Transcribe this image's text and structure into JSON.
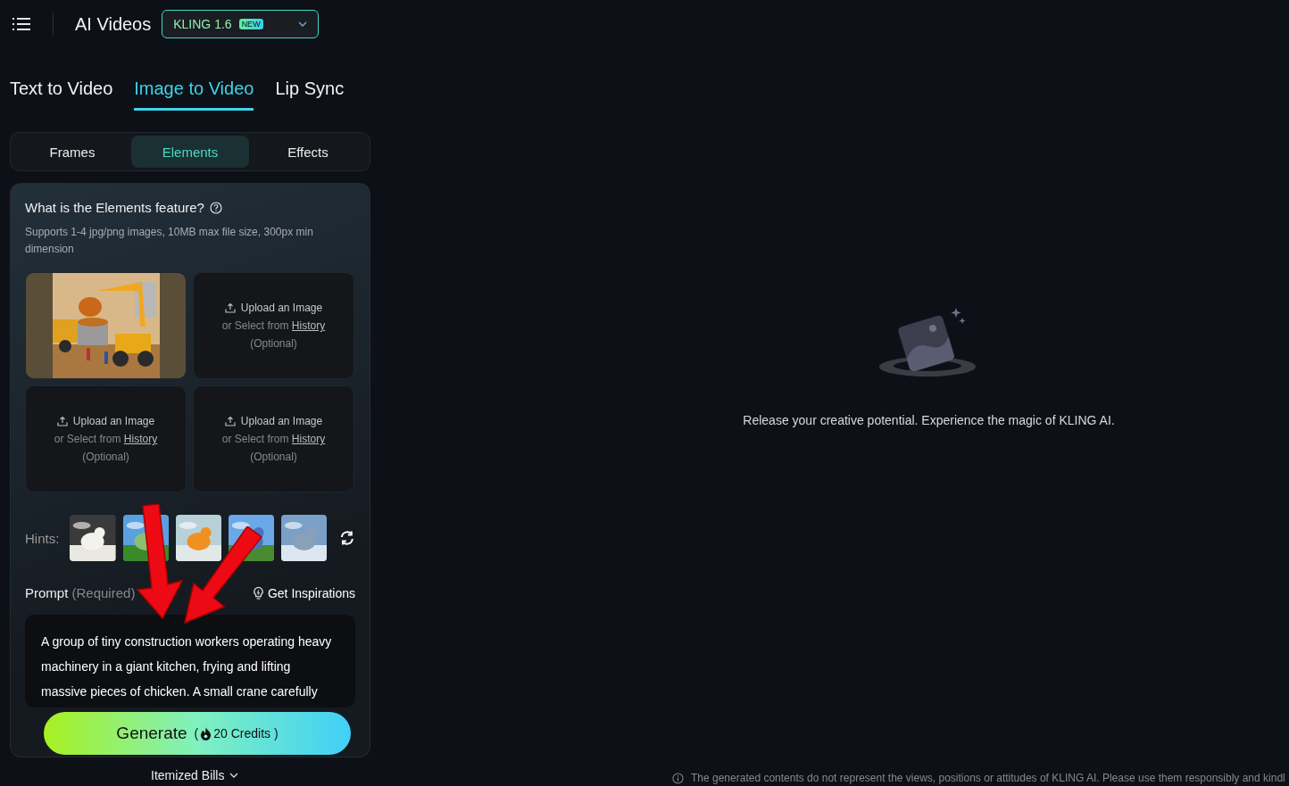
{
  "header": {
    "title": "AI Videos",
    "model": {
      "label": "KLING 1.6",
      "badge": "NEW"
    }
  },
  "tabs": [
    {
      "label": "Text to Video",
      "selected": false
    },
    {
      "label": "Image to Video",
      "selected": true
    },
    {
      "label": "Lip Sync",
      "selected": false
    }
  ],
  "modes": [
    {
      "label": "Frames",
      "selected": false
    },
    {
      "label": "Elements",
      "selected": true
    },
    {
      "label": "Effects",
      "selected": false
    }
  ],
  "elements": {
    "title": "What is the Elements feature?",
    "info": "Supports 1-4 jpg/png images, 10MB max file size, 300px min dimension",
    "slots": [
      {
        "kind": "picture"
      },
      {
        "kind": "empty",
        "label": "Upload an Image",
        "prefix": "or Select from",
        "link": "History",
        "note": "(Optional)"
      },
      {
        "kind": "empty",
        "label": "Upload an Image",
        "prefix": "or Select from",
        "link": "History",
        "note": "(Optional)"
      },
      {
        "kind": "empty",
        "label": "Upload an Image",
        "prefix": "or Select from",
        "link": "History",
        "note": "(Optional)"
      }
    ],
    "hints_label": "Hints:",
    "hints": [
      {
        "kind": "picture"
      },
      {
        "kind": "picture"
      },
      {
        "kind": "picture"
      },
      {
        "kind": "picture"
      },
      {
        "kind": "picture"
      }
    ],
    "prompt_label": "Prompt",
    "prompt_note": "(Required)",
    "inspirations": "Get Inspirations",
    "prompt": "A group of tiny construction workers operating heavy machinery in a giant kitchen, frying and lifting massive pieces of chicken. A small crane carefully"
  },
  "generate": {
    "label": "Generate",
    "open": "(",
    "credits": "20 Credits",
    "close": ")"
  },
  "bills": "Itemized Bills",
  "empty_state": "Release your creative potential. Experience the magic of KLING AI.",
  "disclaimer": "The generated contents do not represent the views, positions or attitudes of KLING AI. Please use them responsibly and kindl"
}
